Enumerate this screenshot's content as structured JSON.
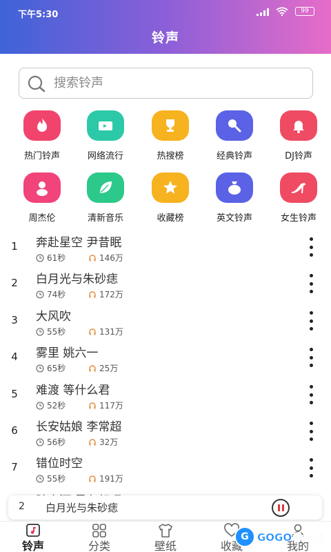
{
  "status": {
    "time": "下午5:30",
    "battery": "99"
  },
  "header": {
    "title": "铃声"
  },
  "search": {
    "placeholder": "搜索铃声"
  },
  "categories": [
    {
      "label": "热门铃声",
      "icon": "flame-icon",
      "color": "#f0446c"
    },
    {
      "label": "网络流行",
      "icon": "ticket-icon",
      "color": "#2cc9a8"
    },
    {
      "label": "热搜榜",
      "icon": "trophy-icon",
      "color": "#f7b21f"
    },
    {
      "label": "经典铃声",
      "icon": "microphone-icon",
      "color": "#5b62e6"
    },
    {
      "label": "DJ铃声",
      "icon": "bell-icon",
      "color": "#ef4b63"
    },
    {
      "label": "周杰伦",
      "icon": "person-icon",
      "color": "#f0447a"
    },
    {
      "label": "清新音乐",
      "icon": "leaf-icon",
      "color": "#2cc98a"
    },
    {
      "label": "收藏榜",
      "icon": "star-icon",
      "color": "#f7b21f"
    },
    {
      "label": "英文铃声",
      "icon": "money-bag-icon",
      "color": "#5b62e6"
    },
    {
      "label": "女生铃声",
      "icon": "high-heel-icon",
      "color": "#ef4b63"
    }
  ],
  "songs": [
    {
      "index": "1",
      "title": "奔赴星空 尹昔眠",
      "duration": "61秒",
      "plays": "146万"
    },
    {
      "index": "2",
      "title": "白月光与朱砂痣",
      "duration": "74秒",
      "plays": "172万"
    },
    {
      "index": "3",
      "title": "大风吹",
      "duration": "55秒",
      "plays": "131万"
    },
    {
      "index": "4",
      "title": "雾里 姚六一",
      "duration": "65秒",
      "plays": "25万"
    },
    {
      "index": "5",
      "title": "难渡 等什么君",
      "duration": "52秒",
      "plays": "117万"
    },
    {
      "index": "6",
      "title": "长安姑娘 李常超",
      "duration": "56秒",
      "plays": "32万"
    },
    {
      "index": "7",
      "title": "错位时空",
      "duration": "55秒",
      "plays": "191万"
    }
  ],
  "partial_song": {
    "title": "踏山河 是七叔呢"
  },
  "player": {
    "index": "2",
    "title": "白月光与朱砂痣"
  },
  "tabs": [
    {
      "label": "铃声",
      "icon": "music-note-icon",
      "active": true
    },
    {
      "label": "分类",
      "icon": "grid-icon",
      "active": false
    },
    {
      "label": "壁纸",
      "icon": "tshirt-icon",
      "active": false
    },
    {
      "label": "收藏",
      "icon": "heart-icon",
      "active": false
    },
    {
      "label": "我的",
      "icon": "user-icon",
      "active": false
    }
  ],
  "watermark": {
    "logo": "G",
    "text": "GOGO手游网"
  }
}
